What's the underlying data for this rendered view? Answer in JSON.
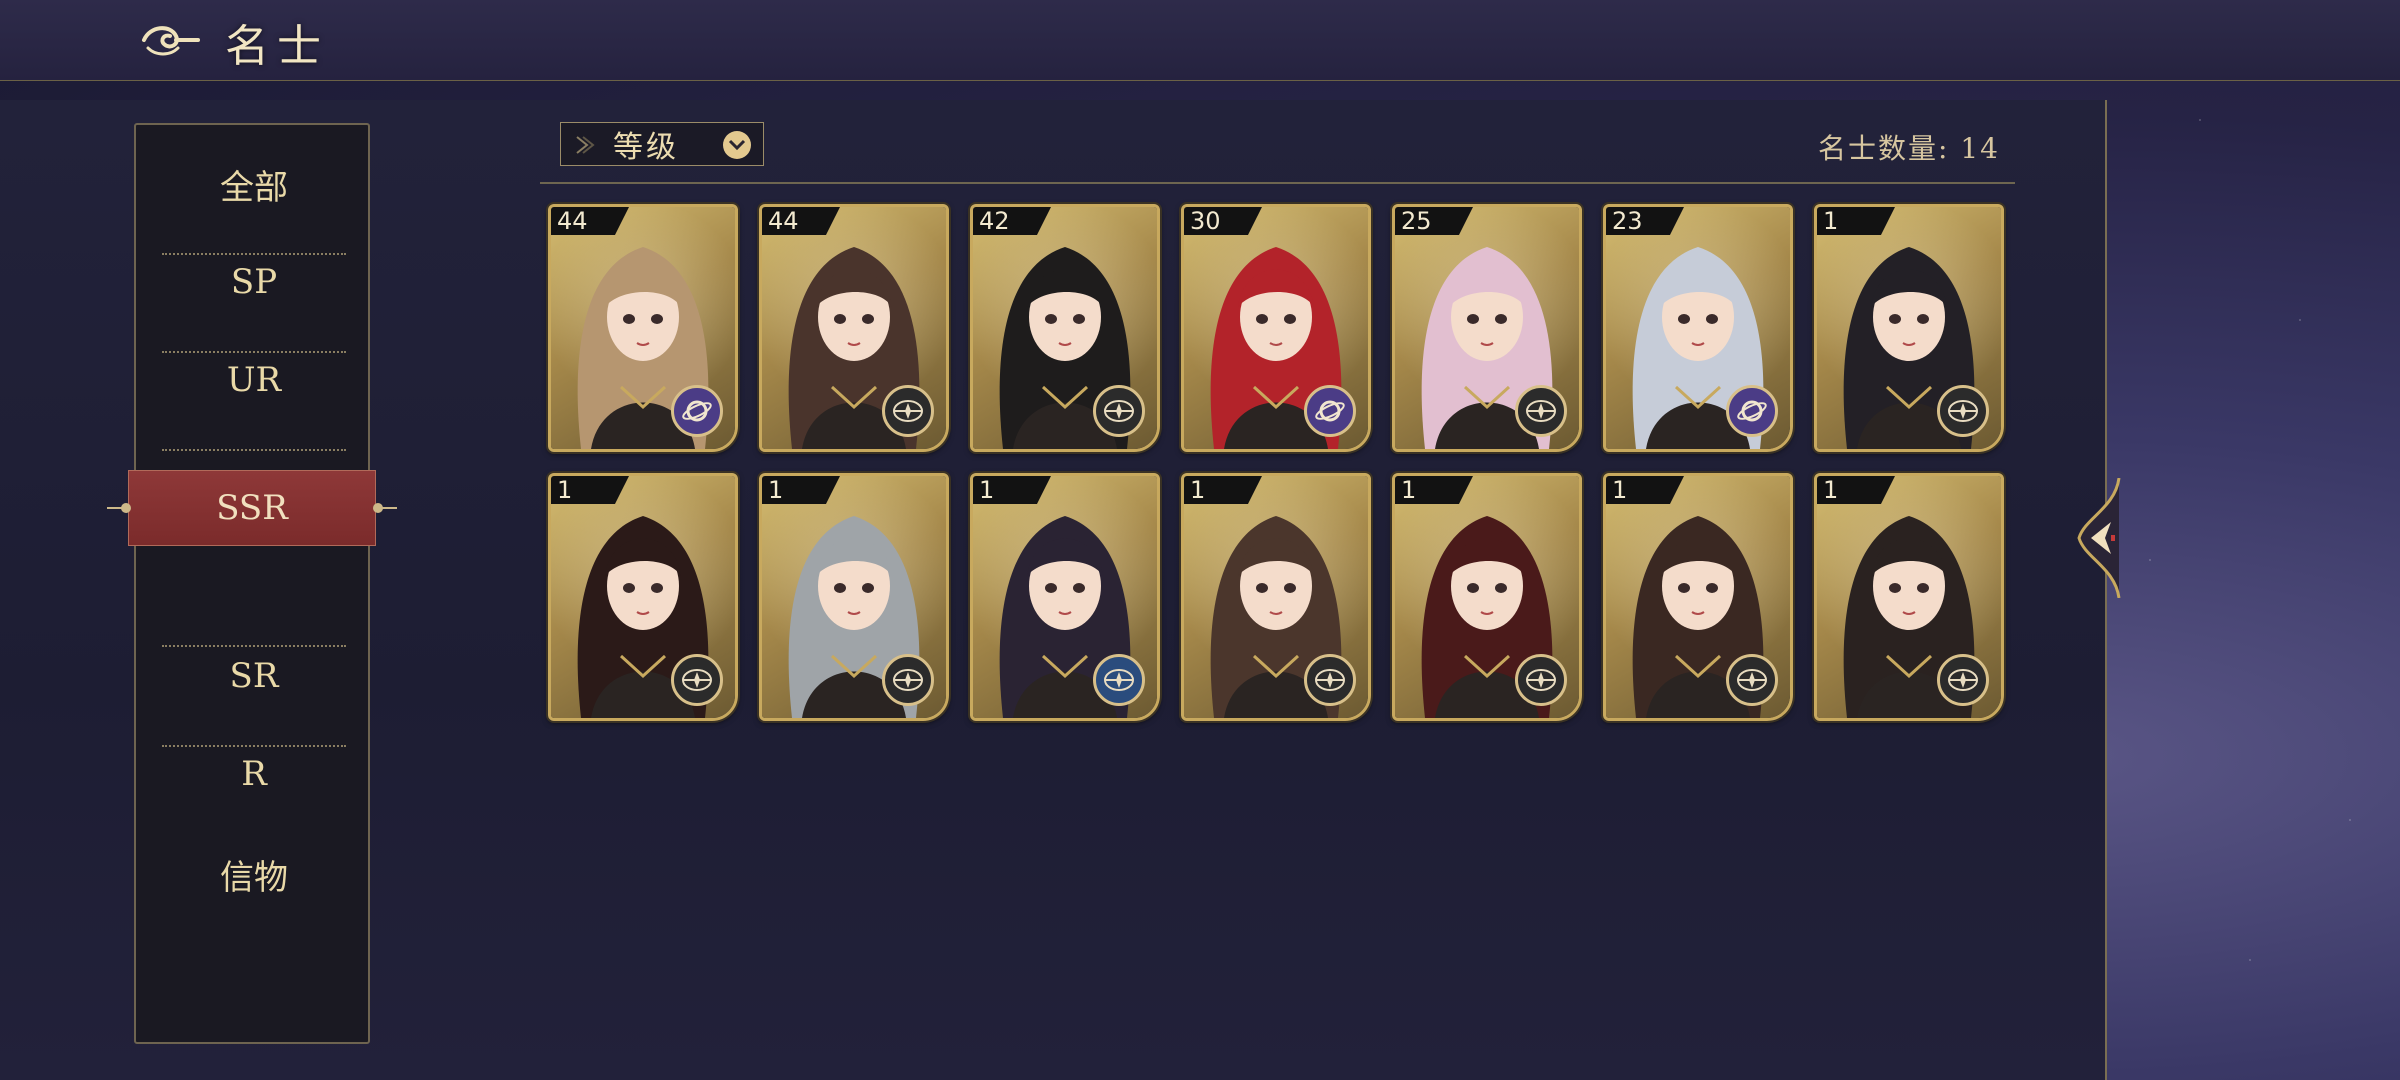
{
  "header": {
    "title": "名士"
  },
  "sidebar": {
    "items": [
      {
        "label": "全部"
      },
      {
        "label": "SP"
      },
      {
        "label": "UR"
      },
      {
        "label": "SSR"
      },
      {
        "label": "SR"
      },
      {
        "label": "R"
      },
      {
        "label": "信物"
      }
    ],
    "active": "SSR"
  },
  "toolbar": {
    "sort_label": "等级",
    "count_text": "名士数量: 14"
  },
  "cards": [
    {
      "level": "44",
      "badge": "planet-icon",
      "badge_color": "#4b3c86",
      "hair": "#b69670"
    },
    {
      "level": "44",
      "badge": "compass-icon",
      "badge_color": "#2b2b2b",
      "hair": "#4a342c"
    },
    {
      "level": "42",
      "badge": "compass-icon",
      "badge_color": "#2b2b2b",
      "hair": "#1e1c1c"
    },
    {
      "level": "30",
      "badge": "planet-icon",
      "badge_color": "#4b3c86",
      "hair": "#b3232a"
    },
    {
      "level": "25",
      "badge": "compass-icon",
      "badge_color": "#2b2b2b",
      "hair": "#e2bfd0"
    },
    {
      "level": "23",
      "badge": "planet-icon",
      "badge_color": "#4b3c86",
      "hair": "#c6ccd8"
    },
    {
      "level": "1",
      "badge": "compass-icon",
      "badge_color": "#2b2b2b",
      "hair": "#232026"
    },
    {
      "level": "1",
      "badge": "compass-icon",
      "badge_color": "#2b2b2b",
      "hair": "#2b1a18"
    },
    {
      "level": "1",
      "badge": "compass-icon",
      "badge_color": "#2b2b2b",
      "hair": "#9fa4a8"
    },
    {
      "level": "1",
      "badge": "compass-icon",
      "badge_color": "#2a4c7d",
      "hair": "#2a2333"
    },
    {
      "level": "1",
      "badge": "compass-icon",
      "badge_color": "#2b2b2b",
      "hair": "#4b362c"
    },
    {
      "level": "1",
      "badge": "compass-icon",
      "badge_color": "#2b2b2b",
      "hair": "#4a1a1a"
    },
    {
      "level": "1",
      "badge": "compass-icon",
      "badge_color": "#2b2b2b",
      "hair": "#3a2822"
    },
    {
      "level": "1",
      "badge": "compass-icon",
      "badge_color": "#2b2b2b",
      "hair": "#2a2220"
    }
  ],
  "colors": {
    "gold": "#c8a95e",
    "active_tab": "#8e3838",
    "text_light": "#e9d9a8"
  }
}
